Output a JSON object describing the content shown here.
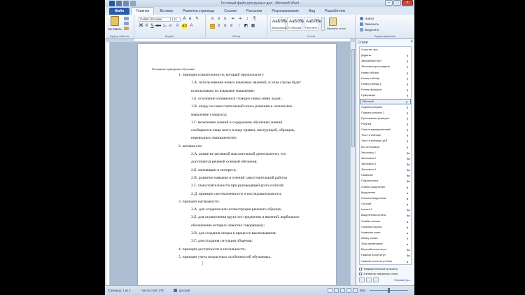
{
  "window": {
    "title": "Тестовый файл для ручных дел - Microsoft Word",
    "controls": [
      "–",
      "□",
      "×"
    ]
  },
  "tabs": [
    {
      "label": "Файл",
      "kind": "file"
    },
    {
      "label": "Главная",
      "kind": "active"
    },
    {
      "label": "Вставка",
      "kind": ""
    },
    {
      "label": "Разметка страницы",
      "kind": ""
    },
    {
      "label": "Ссылки",
      "kind": ""
    },
    {
      "label": "Рассылки",
      "kind": ""
    },
    {
      "label": "Рецензирование",
      "kind": ""
    },
    {
      "label": "Вид",
      "kind": ""
    },
    {
      "label": "Разработчик",
      "kind": ""
    }
  ],
  "ribbon": {
    "clipboard": {
      "paste": "Вставить",
      "label": "Буфер обмена"
    },
    "font": {
      "name": "Calibri (Основн",
      "size": "11",
      "label": "Шрифт"
    },
    "paragraph": {
      "label": "Абзац"
    },
    "styles": {
      "items": [
        {
          "sample": "АаБбВвГг",
          "name": "Абзац списка"
        },
        {
          "sample": "АаБбВвГг",
          "name": "¶ Обычный"
        },
        {
          "sample": "АаБбВвГг",
          "name": "¶ Без инте..."
        }
      ],
      "change": "Изменить стили",
      "label": "Стили"
    },
    "editing": {
      "find": "Найти",
      "replace": "Заменить",
      "select": "Выделить",
      "label": "Редактирование"
    }
  },
  "document": {
    "header": "Основные принципы обучения",
    "lines": [
      "1. принцип сознательности, который предполагает:",
      "1.А. использование новых языковых явлений, в этом случае будет",
      "использовано их языковое мышление;",
      "1.Б. осознание учащимися стоящих перед ними задач;",
      "1.В. опору на самостоятельный поиск решения и логическое",
      "мышление учащихся;",
      "1.Г. включение знаний в содержание обучения (знания",
      "сообщаются чаще всего в виде правил, инструкций, образцов,",
      "переводных эквивалентов);",
      "2. активности:",
      "2.А. развитие активной мыслительной деятельности, что",
      "достигается речевой основой обучения;",
      "2.Б. мотивации и интереса;",
      "2.В. развитие навыков и умений самостоятельной работы",
      "2.Г. самостоятельности при руководящей роли учителя;",
      "2.Д. принцип систематичности и последовательности;",
      "3. принцип наглядности:",
      "3.А. для создания или иллюстрации речевого образца;",
      "3.Б. для ограничения круга тех предметов и явлений, вербальное",
      "обозначение которых известно говорящему;",
      "3.В. для создания опоры в процессе высказывания;",
      "3.Г. для создания ситуации общения;",
      "4. принцип доступности и посильности;",
      "5. принцип учета возрастных особенностей обучаемых."
    ]
  },
  "styles_pane": {
    "title": "Стили",
    "close": "×",
    "items": [
      {
        "label": "Очистить все",
        "mark": ""
      },
      {
        "label": "Додатки",
        "mark": "¶"
      },
      {
        "label": "Звичайний текст",
        "mark": "¶"
      },
      {
        "label": "Заголовок для раздела",
        "mark": "¶"
      },
      {
        "label": "Назва таблиці",
        "mark": "¶"
      },
      {
        "label": "Номер таблиці",
        "mark": "¶"
      },
      {
        "label": "Номер таблиці 2",
        "mark": "¶"
      },
      {
        "label": "Номер формулы",
        "mark": "¶"
      },
      {
        "label": "Нумерация",
        "mark": "¶"
      },
      {
        "label": "Обычный",
        "mark": "¶"
      },
      {
        "label": "Подпись рисунка",
        "mark": "¶"
      },
      {
        "label": "Подпись рисунка 2",
        "mark": "¶"
      },
      {
        "label": "Приложение формулы",
        "mark": "¶"
      },
      {
        "label": "Рисунок",
        "mark": "¶"
      },
      {
        "label": "Список маркированный",
        "mark": "¶"
      },
      {
        "label": "Текст в таблице",
        "mark": "¶"
      },
      {
        "label": "Текст в таблице ЦАЯ",
        "mark": "¶"
      },
      {
        "label": "Без интервала",
        "mark": "¶"
      },
      {
        "label": "Заголовок 1",
        "mark": "¶a"
      },
      {
        "label": "Заголовок 2",
        "mark": "¶a"
      },
      {
        "label": "Заголовок 3",
        "mark": "¶a"
      },
      {
        "label": "Заголовок 4",
        "mark": "¶a"
      },
      {
        "label": "Название",
        "mark": "¶a"
      },
      {
        "label": "Подзаголовок",
        "mark": "¶a"
      },
      {
        "label": "Слабое выделение",
        "mark": "a"
      },
      {
        "label": "Выделение",
        "mark": "a"
      },
      {
        "label": "Сильное выделение",
        "mark": "a"
      },
      {
        "label": "Строгий",
        "mark": "a"
      },
      {
        "label": "Цитата 2",
        "mark": "¶a"
      },
      {
        "label": "Выделенная цитата",
        "mark": "¶a"
      },
      {
        "label": "Слабая ссылка",
        "mark": "a"
      },
      {
        "label": "Сильная ссылка",
        "mark": "a"
      },
      {
        "label": "Название книги",
        "mark": "a"
      },
      {
        "label": "Абзац списка",
        "mark": "¶"
      },
      {
        "label": "Знак примечания",
        "mark": "a"
      },
      {
        "label": "Верхний колонтитул",
        "mark": "¶a"
      },
      {
        "label": "Нижний колонтитул",
        "mark": "¶a"
      },
      {
        "label": "Нижний колонтитул Знак",
        "mark": "a"
      }
    ],
    "selected_index": 9,
    "preview_label": "Предварительный просмотр",
    "disable_linked": "Отключить связанные стили",
    "params": "Параметры..."
  },
  "status": {
    "page": "Страница: 1 из 2",
    "words": "Число слов: 278",
    "lang": "русский",
    "zoom": "85%"
  }
}
